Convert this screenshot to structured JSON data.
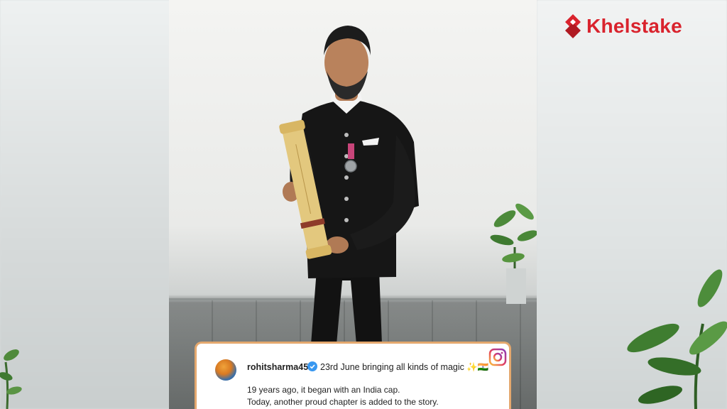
{
  "brand": {
    "name": "Khelstake",
    "accent": "#d9232d"
  },
  "post": {
    "username": "rohitsharma45",
    "caption": "23rd June bringing all kinds of magic ✨🇮🇳",
    "line1": "19 years ago, it began with an India cap.",
    "line2": "Today, another proud chapter is added to the story.",
    "icons": [
      "verified-icon",
      "instagram-icon"
    ]
  }
}
